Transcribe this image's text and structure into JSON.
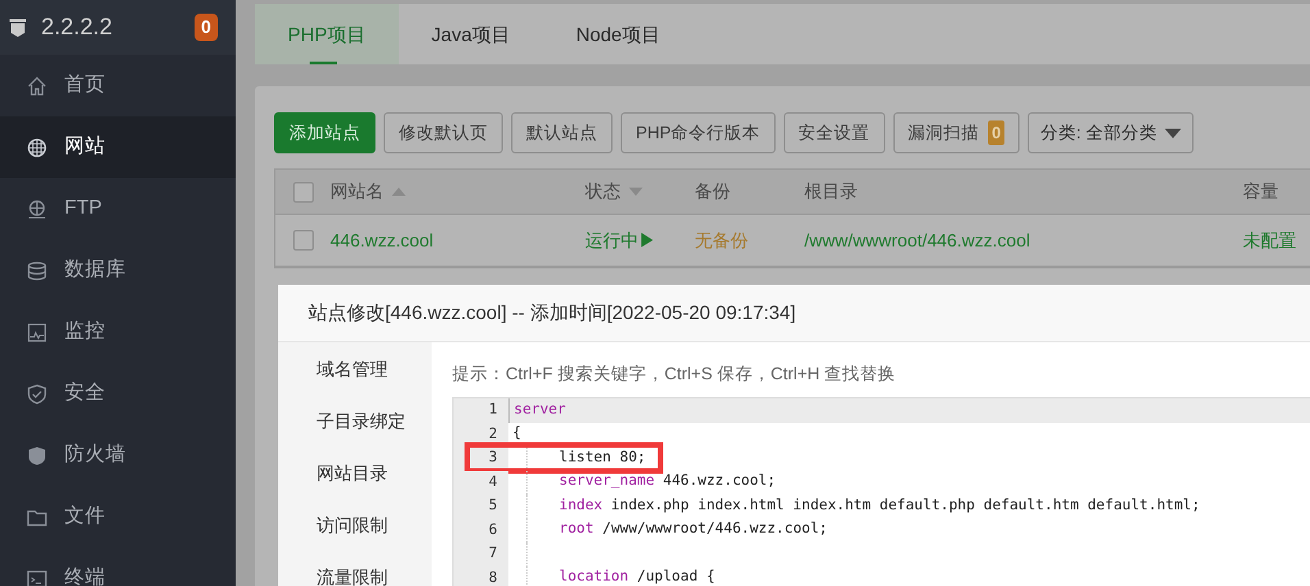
{
  "sidebar": {
    "server": "2.2.2.2",
    "badge": "0",
    "items": [
      {
        "label": "首页",
        "selected": false
      },
      {
        "label": "网站",
        "selected": true
      },
      {
        "label": "FTP",
        "selected": false
      },
      {
        "label": "数据库",
        "selected": false
      },
      {
        "label": "监控",
        "selected": false
      },
      {
        "label": "安全",
        "selected": false
      },
      {
        "label": "防火墙",
        "selected": false
      },
      {
        "label": "文件",
        "selected": false
      },
      {
        "label": "终端",
        "selected": false
      }
    ]
  },
  "tabs": [
    {
      "label": "PHP项目",
      "selected": true
    },
    {
      "label": "Java项目",
      "selected": false
    },
    {
      "label": "Node项目",
      "selected": false
    }
  ],
  "toolbar": {
    "buttons": [
      {
        "label": "添加站点",
        "kind": "primary"
      },
      {
        "label": "修改默认页",
        "kind": "plain"
      },
      {
        "label": "默认站点",
        "kind": "plain"
      },
      {
        "label": "PHP命令行版本",
        "kind": "plain"
      },
      {
        "label": "安全设置",
        "kind": "plain"
      },
      {
        "label": "漏洞扫描",
        "kind": "plain",
        "badge": "0"
      }
    ],
    "category": "分类: 全部分类"
  },
  "table": {
    "all_checked": false,
    "columns": [
      {
        "label": "网站名"
      },
      {
        "label": "状态"
      },
      {
        "label": "备份"
      },
      {
        "label": "根目录"
      },
      {
        "label": "容量"
      }
    ],
    "rows": [
      {
        "checked": false,
        "name": "446.wzz.cool",
        "status": "运行中▶",
        "backup": "无备份",
        "root": "/www/wwwroot/446.wzz.cool",
        "quota": "未配置"
      }
    ]
  },
  "dialog": {
    "title": "站点修改[446.wzz.cool] -- 添加时间[2022-05-20 09:17:34]",
    "menu": [
      "域名管理",
      "子目录绑定",
      "网站目录",
      "访问限制",
      "流量限制"
    ],
    "hint": "提示：Ctrl+F 搜索关键字，Ctrl+S 保存，Ctrl+H 查找替换",
    "lines": [
      {
        "number": "1",
        "indented": false,
        "active": true,
        "highlighted": false,
        "tokens": [
          {
            "text": "server",
            "kind": "keyword"
          }
        ]
      },
      {
        "number": "2",
        "indented": false,
        "active": false,
        "highlighted": false,
        "tokens": [
          {
            "text": "{",
            "kind": "plain"
          }
        ]
      },
      {
        "number": "3",
        "indented": true,
        "active": false,
        "highlighted": true,
        "tokens": [
          {
            "text": "listen 80;",
            "kind": "plain"
          }
        ]
      },
      {
        "number": "4",
        "indented": true,
        "active": false,
        "highlighted": false,
        "tokens": [
          {
            "text": "server_name",
            "kind": "keyword"
          },
          {
            "text": " 446.wzz.cool;",
            "kind": "plain"
          }
        ]
      },
      {
        "number": "5",
        "indented": true,
        "active": false,
        "highlighted": false,
        "tokens": [
          {
            "text": "index",
            "kind": "keyword"
          },
          {
            "text": " index.php index.html index.htm default.php default.htm default.html;",
            "kind": "plain"
          }
        ]
      },
      {
        "number": "6",
        "indented": true,
        "active": false,
        "highlighted": false,
        "tokens": [
          {
            "text": "root",
            "kind": "keyword"
          },
          {
            "text": " /www/wwwroot/446.wzz.cool;",
            "kind": "plain"
          }
        ]
      },
      {
        "number": "7",
        "indented": true,
        "active": false,
        "highlighted": false
      },
      {
        "number": "8",
        "indented": true,
        "active": false,
        "highlighted": false,
        "tokens": [
          {
            "text": "location",
            "kind": "keyword"
          },
          {
            "text": " /upload {",
            "kind": "plain"
          }
        ]
      }
    ]
  }
}
